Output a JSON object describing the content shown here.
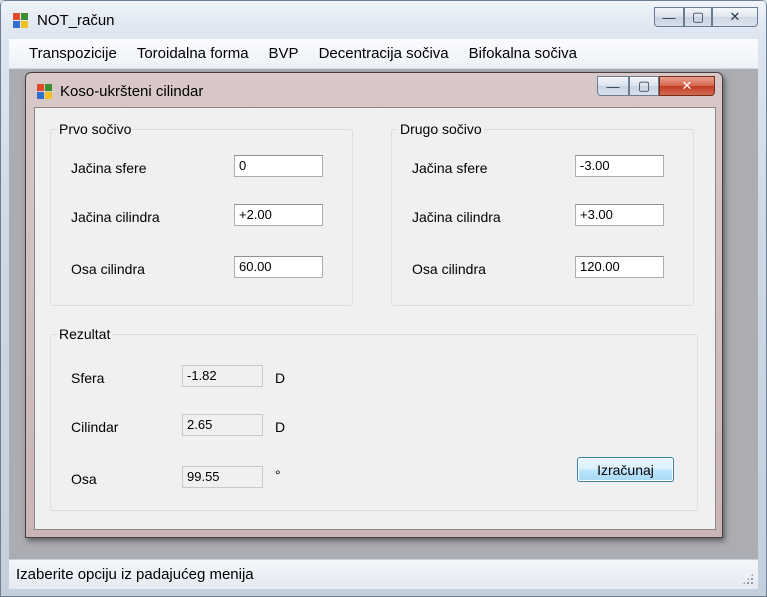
{
  "main_window": {
    "title": "NOT_račun",
    "caption": {
      "minimize": "—",
      "maximize": "▢",
      "close": "✕"
    }
  },
  "menu": {
    "items": [
      "Transpozicije",
      "Toroidalna forma",
      "BVP",
      "Decentracija sočiva",
      "Bifokalna sočiva"
    ]
  },
  "status_bar": {
    "text": "Izaberite opciju iz padajućeg menija"
  },
  "dialog": {
    "title": "Koso-ukršteni cilindar",
    "caption": {
      "minimize": "—",
      "maximize": "▢",
      "close": "✕"
    },
    "first_lens": {
      "title": "Prvo sočivo",
      "sphere_label": "Jačina sfere",
      "sphere_value": "0",
      "cylinder_label": "Jačina cilindra",
      "cylinder_value": "+2.00",
      "axis_label": "Osa cilindra",
      "axis_value": "60.00"
    },
    "second_lens": {
      "title": "Drugo sočivo",
      "sphere_label": "Jačina sfere",
      "sphere_value": "-3.00",
      "cylinder_label": "Jačina cilindra",
      "cylinder_value": "+3.00",
      "axis_label": "Osa cilindra",
      "axis_value": "120.00"
    },
    "result": {
      "title": "Rezultat",
      "sphere_label": "Sfera",
      "sphere_value": "-1.82",
      "sphere_unit": "D",
      "cylinder_label": "Cilindar",
      "cylinder_value": "2.65",
      "cylinder_unit": "D",
      "axis_label": "Osa",
      "axis_value": "99.55",
      "axis_unit": "°",
      "calculate_button": "Izračunaj"
    }
  },
  "colors": {
    "titlebar_active": "#dfe7f2",
    "dialog_titlebar": "#d9c8c8",
    "close_button": "#c23b22",
    "default_button_border": "#3c7fb1"
  }
}
